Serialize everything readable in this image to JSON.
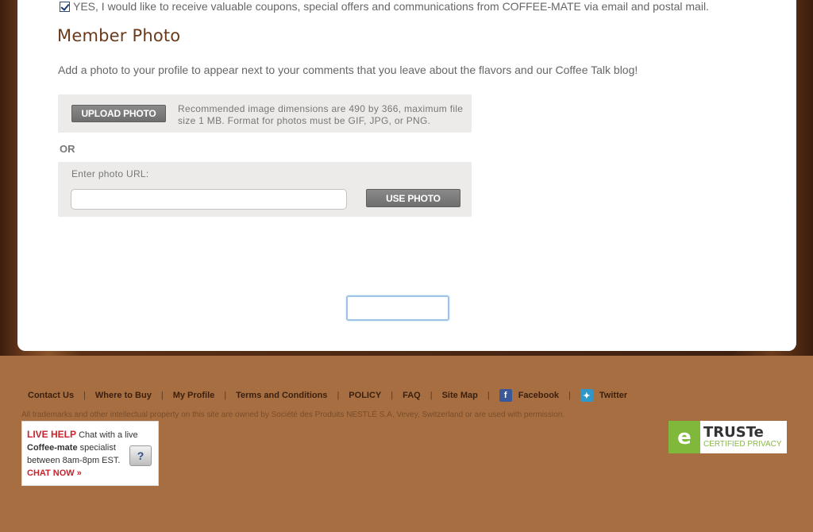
{
  "optin": {
    "label": "YES, I would like to receive valuable coupons, special offers and communications from COFFEE-MATE via email and postal mail.",
    "checked": true
  },
  "member_photo": {
    "title": "Member Photo",
    "intro": "Add a photo to your profile to appear next to your comments that you leave about the flavors and our Coffee Talk blog!",
    "upload_button": "UPLOAD PHOTO",
    "upload_note": "Recommended image dimensions are 490 by 366, maximum file size 1 MB. Format for photos must be GIF, JPG, or PNG.",
    "or_label": "OR",
    "url_label": "Enter photo URL:",
    "url_value": "",
    "use_button": "USE PHOTO"
  },
  "footer": {
    "links": [
      {
        "label": "Contact Us"
      },
      {
        "label": "Where to Buy"
      },
      {
        "label": "My Profile"
      },
      {
        "label": "Terms and Conditions"
      },
      {
        "label": "POLICY"
      },
      {
        "label": "FAQ"
      },
      {
        "label": "Site Map"
      },
      {
        "label": "Facebook",
        "icon": "facebook-icon"
      },
      {
        "label": "Twitter",
        "icon": "twitter-icon"
      }
    ],
    "legal": "All trademarks and other intellectual property on this site are owned by Société des Produits NESTLÉ S.A, Vevey, Switzerland or are used with permission."
  },
  "live_help": {
    "title": "LIVE HELP",
    "line1": "Chat with a live",
    "brand": "Coffee-mate",
    "line2": "specialist",
    "line3": "between 8am-8pm EST.",
    "cta": "CHAT NOW »"
  },
  "truste": {
    "name": "TRUSTe",
    "subtitle": "CERTIFIED PRIVACY"
  },
  "colors": {
    "accent_brown": "#6b3a1b",
    "footer_bg": "#a76f41",
    "live_help_red": "#c8232c",
    "truste_green": "#7fb83a"
  }
}
